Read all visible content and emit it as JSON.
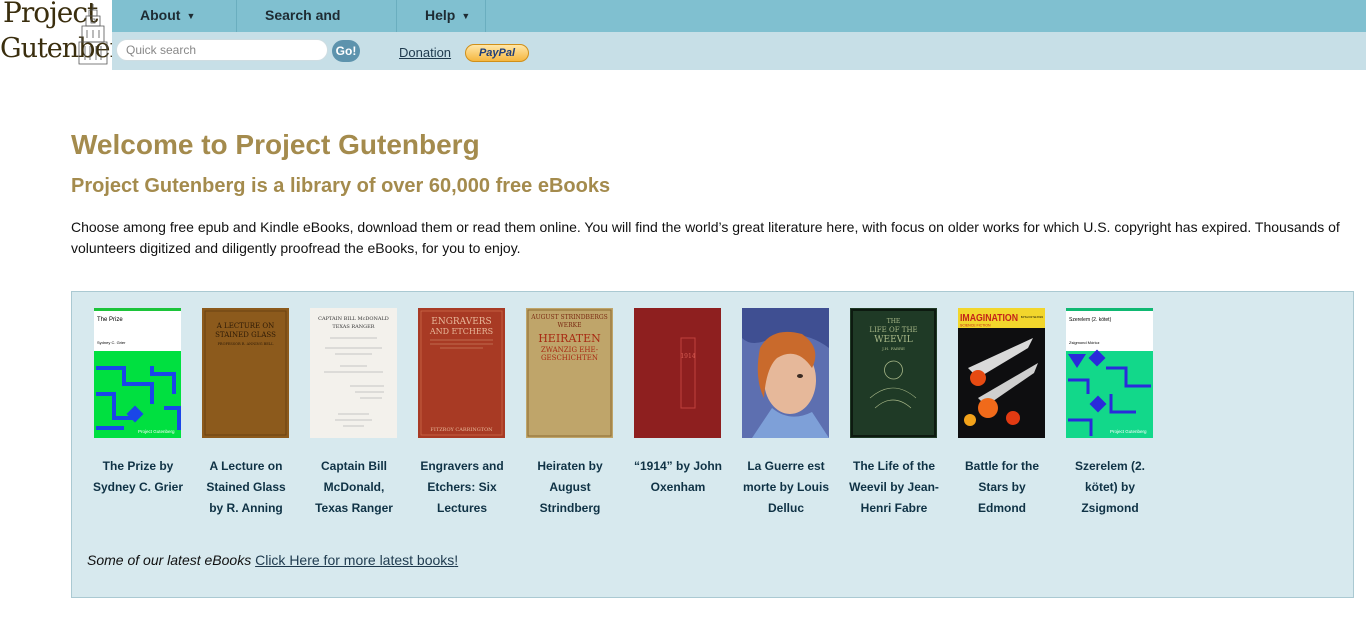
{
  "logo": {
    "line1": "Project",
    "line2": "Gutenberg"
  },
  "nav": [
    {
      "label": "About"
    },
    {
      "label": "Search and Browse"
    },
    {
      "label": "Help"
    }
  ],
  "search": {
    "placeholder": "Quick search",
    "go_label": "Go!"
  },
  "donation": {
    "label": "Donation",
    "paypal_label": "PayPal"
  },
  "main": {
    "title": "Welcome to Project Gutenberg",
    "subtitle": "Project Gutenberg is a library of over 60,000 free eBooks",
    "intro": "Choose among free epub and Kindle eBooks, download them or read them online. You will find the world’s great literature here, with focus on older works for which U.S. copyright has expired. Thousands of volunteers digitized and diligently proofread the eBooks, for you to enjoy."
  },
  "books": [
    {
      "label": "The Prize by Sydney C. Grier",
      "cover_text": [
        "The Prize",
        "Sydney C. Grier",
        "Project Gutenberg"
      ]
    },
    {
      "label": "A Lecture on Stained Glass by R. Anning",
      "cover_text": [
        "A LECTURE ON",
        "STAINED GLASS",
        "PROFESSOR R. ANNING BELL"
      ]
    },
    {
      "label": "Captain Bill McDonald, Texas Ranger",
      "cover_text": [
        "CAPTAIN BILL McDONALD",
        "TEXAS RANGER"
      ]
    },
    {
      "label": "Engravers and Etchers: Six Lectures",
      "cover_text": [
        "ENGRAVERS",
        "AND ETCHERS",
        "FITZROY CARRINGTON"
      ]
    },
    {
      "label": "Heiraten by August Strindberg",
      "cover_text": [
        "AUGUST STRINDBERGS",
        "WERKE",
        "HEIRATEN",
        "ZWANZIG EHE-",
        "GESCHICHTEN"
      ]
    },
    {
      "label": "“1914” by John Oxenham",
      "cover_text": [
        "1914"
      ]
    },
    {
      "label": "La Guerre est morte by Louis Delluc",
      "cover_text": []
    },
    {
      "label": "The Life of the Weevil by Jean-Henri Fabre",
      "cover_text": [
        "THE",
        "LIFE OF THE",
        "WEEVIL",
        "J.H. FABRE"
      ]
    },
    {
      "label": "Battle for the Stars by Edmond",
      "cover_text": [
        "IMAGINATION",
        "SCIENCE FICTION",
        "BATTLE FOR THE STARS"
      ]
    },
    {
      "label": "Szerelem (2. kötet) by Zsigmond",
      "cover_text": [
        "Szerelem (2. kötet)",
        "Zsigmond Móricz",
        "Project Gutenberg"
      ]
    }
  ],
  "latest": {
    "prefix": "Some of our latest eBooks",
    "link": "Click Here for more latest books",
    "suffix": "!"
  },
  "colors": {
    "nav_bg": "#80c0d0",
    "subnav_bg": "#c7dfe7",
    "heading": "#a48b4d",
    "box_bg": "#d7e9ee",
    "link": "#1e3a4e"
  },
  "icons": {
    "caret": "caret-down-icon",
    "logo_building": "building-icon"
  }
}
